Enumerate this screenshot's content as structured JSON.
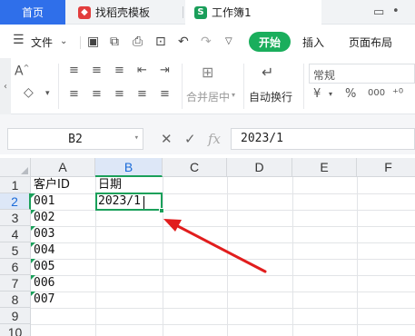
{
  "tabs": {
    "home": "首页",
    "templates": "找稻壳模板",
    "workbook": "工作簿1"
  },
  "window_icons": [
    "monitor-icon",
    "dot-icon"
  ],
  "menubar": {
    "menu_label": "文件",
    "start": "开始",
    "insert": "插入",
    "page_layout": "页面布局"
  },
  "ribbon": {
    "merge_center": "合并居中",
    "wrap_text": "自动换行",
    "number_format": "常规",
    "currency_symbol": "¥",
    "percent_symbol": "%",
    "thousands_symbol": "000"
  },
  "formula_bar": {
    "name_box": "B2",
    "cancel_symbol": "✕",
    "confirm_symbol": "✓",
    "fx_symbol": "fx",
    "formula_value": "2023/1"
  },
  "columns": [
    "A",
    "B",
    "C",
    "D",
    "E",
    "F"
  ],
  "rows": [
    "1",
    "2",
    "3",
    "4",
    "5",
    "6",
    "7",
    "8",
    "9",
    "10"
  ],
  "active_cell": "B2",
  "cells": {
    "A1": "客户ID",
    "B1": "日期",
    "A2": "001",
    "B2": "2023/1",
    "A3": "002",
    "A4": "003",
    "A5": "004",
    "A6": "005",
    "A7": "006",
    "A8": "007"
  },
  "colors": {
    "accent_blue": "#2f6fea",
    "start_green": "#1aae5c",
    "selection_green": "#1aa05a",
    "annotation_red": "#e11d1d"
  }
}
